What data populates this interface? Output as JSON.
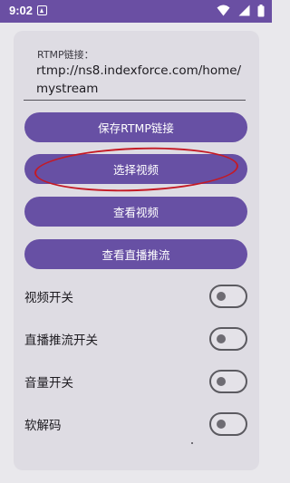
{
  "status_bar": {
    "time": "9:02",
    "notification_icon": "text-notification-icon",
    "wifi_icon": "wifi-icon",
    "signal_icon": "signal-icon",
    "battery_icon": "battery-icon"
  },
  "rtmp_field": {
    "label": "RTMP链接：",
    "value": "rtmp://ns8.indexforce.com/home/mystream"
  },
  "buttons": {
    "save_rtmp": "保存RTMP链接",
    "select_video": "选择视频",
    "view_video": "查看视频",
    "view_live_push": "查看直播推流"
  },
  "toggles": [
    {
      "label": "视频开关",
      "on": false
    },
    {
      "label": "直播推流开关",
      "on": false
    },
    {
      "label": "音量开关",
      "on": false
    },
    {
      "label": "软解码",
      "on": false
    }
  ],
  "colors": {
    "status_bar": "#6a4fa3",
    "button": "#6750a4",
    "annotation": "#c41a25",
    "background": "#e9e8ec",
    "card": "#dedce3"
  }
}
